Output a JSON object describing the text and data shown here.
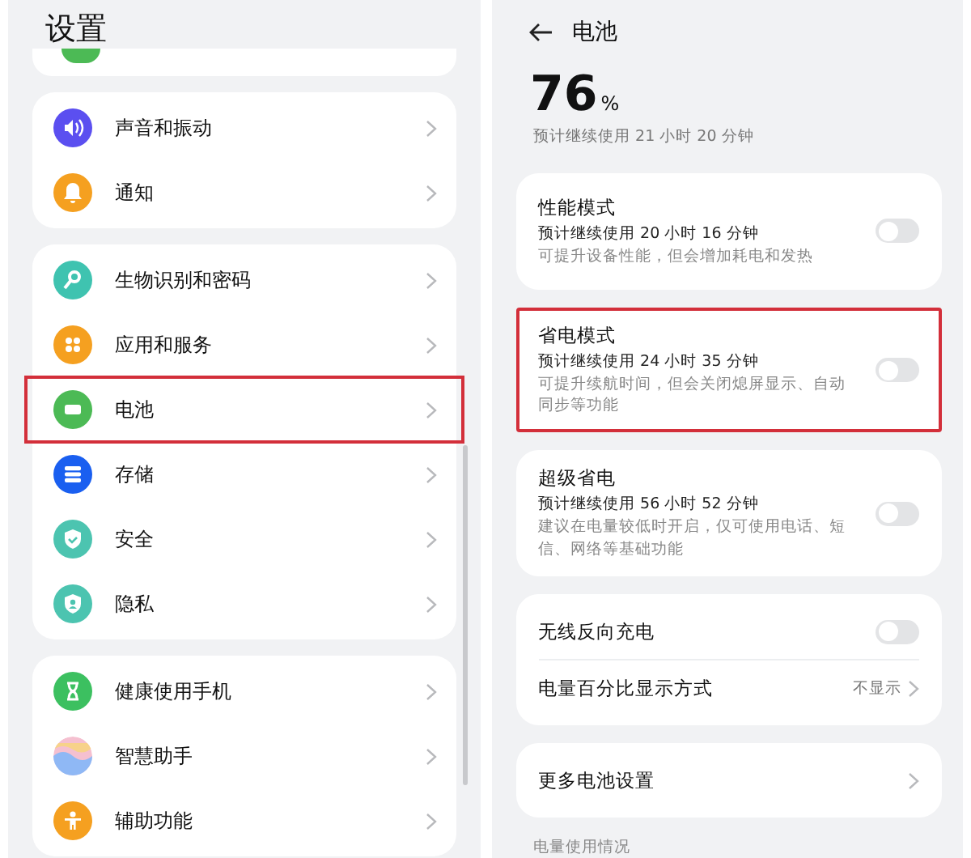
{
  "left": {
    "title": "设置",
    "groups": [
      {
        "items": [
          {
            "label": "声音和振动",
            "color": "#5b4ff0",
            "highlighted": false
          },
          {
            "label": "通知",
            "color": "#f5a020",
            "highlighted": false
          }
        ]
      },
      {
        "items": [
          {
            "label": "生物识别和密码",
            "color": "#3fc3b0",
            "highlighted": false
          },
          {
            "label": "应用和服务",
            "color": "#f5a020",
            "highlighted": false
          },
          {
            "label": "电池",
            "color": "#4cba55",
            "highlighted": true
          },
          {
            "label": "存储",
            "color": "#1a5ff0",
            "highlighted": false
          },
          {
            "label": "安全",
            "color": "#4cc4b0",
            "highlighted": false
          },
          {
            "label": "隐私",
            "color": "#4cc4b0",
            "highlighted": false
          }
        ]
      },
      {
        "items": [
          {
            "label": "健康使用手机",
            "color": "#3cc060",
            "highlighted": false
          },
          {
            "label": "智慧助手",
            "highlighted": false
          },
          {
            "label": "辅助功能",
            "color": "#f5a020",
            "highlighted": false
          }
        ]
      }
    ]
  },
  "right": {
    "title": "电池",
    "percent": "76",
    "unit": "%",
    "estimate": "预计继续使用 21 小时 20 分钟",
    "cards": [
      {
        "highlighted": false,
        "rows": [
          {
            "kind": "mode",
            "title": "性能模式",
            "estimate": "预计继续使用 20 小时 16 分钟",
            "description": "可提升设备性能，但会增加耗电和发热",
            "on": false
          }
        ]
      },
      {
        "highlighted": true,
        "rows": [
          {
            "kind": "mode",
            "title": "省电模式",
            "estimate": "预计继续使用 24 小时 35 分钟",
            "description": "可提升续航时间，但会关闭熄屏显示、自动同步等功能",
            "on": false
          }
        ]
      },
      {
        "highlighted": false,
        "rows": [
          {
            "kind": "mode",
            "title": "超级省电",
            "estimate": "预计继续使用 56 小时 52 分钟",
            "description": "建议在电量较低时开启，仅可使用电话、短信、网络等基础功能",
            "on": false
          }
        ]
      },
      {
        "highlighted": false,
        "rows": [
          {
            "kind": "toggle",
            "title": "无线反向充电",
            "on": false
          },
          {
            "kind": "link",
            "title": "电量百分比显示方式",
            "value": "不显示"
          }
        ]
      },
      {
        "highlighted": false,
        "rows": [
          {
            "kind": "link",
            "title": "更多电池设置"
          }
        ]
      }
    ],
    "footer": "电量使用情况"
  }
}
